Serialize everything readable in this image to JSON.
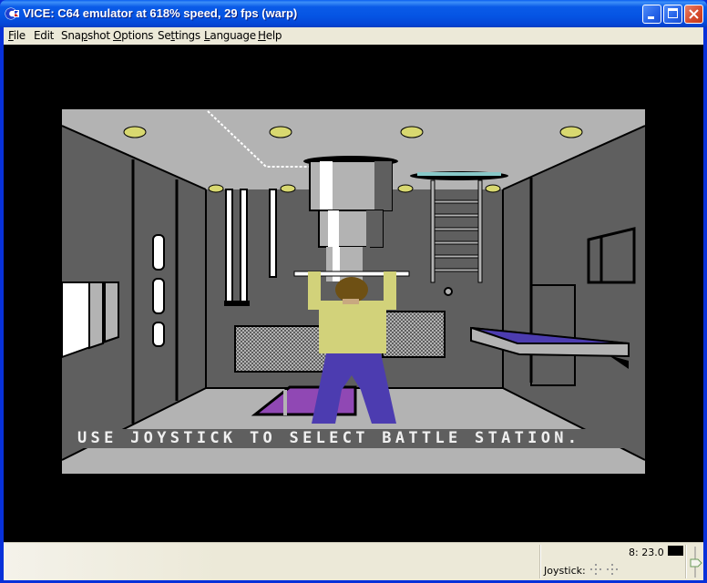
{
  "window": {
    "title": "VICE: C64 emulator at 618% speed, 29 fps (warp)",
    "app_icon": "commodore-logo-icon",
    "controls": [
      "minimize",
      "maximize",
      "close"
    ]
  },
  "menubar": {
    "items": [
      {
        "label": "File",
        "mnemonic": "F"
      },
      {
        "label": "Edit",
        "mnemonic": ""
      },
      {
        "label": "Snapshot",
        "mnemonic": "p"
      },
      {
        "label": "Options",
        "mnemonic": "O"
      },
      {
        "label": "Settings",
        "mnemonic": "t"
      },
      {
        "label": "Language",
        "mnemonic": "L"
      },
      {
        "label": "Help",
        "mnemonic": "H"
      }
    ]
  },
  "emulator_screen": {
    "game_message": "USE JOYSTICK TO SELECT BATTLE STATION.",
    "colors": {
      "border": "#000000",
      "ceiling": "#b3b3b3",
      "wall": "#5f5f5f",
      "floor": "#b3b3b3",
      "shirt": "#d2d27a",
      "pants": "#4c3cb0",
      "hair": "#6e5014",
      "hatch": "#9048b4",
      "light": "#d8d870",
      "ladder_top": "#88c8c8"
    }
  },
  "statusbar": {
    "drive_label": "8: 23.0",
    "joystick_label": "Joystick:",
    "joystick_icons": [
      "joystick-port-1-icon",
      "joystick-port-2-icon"
    ],
    "volume_icon": "volume-slider-icon"
  }
}
